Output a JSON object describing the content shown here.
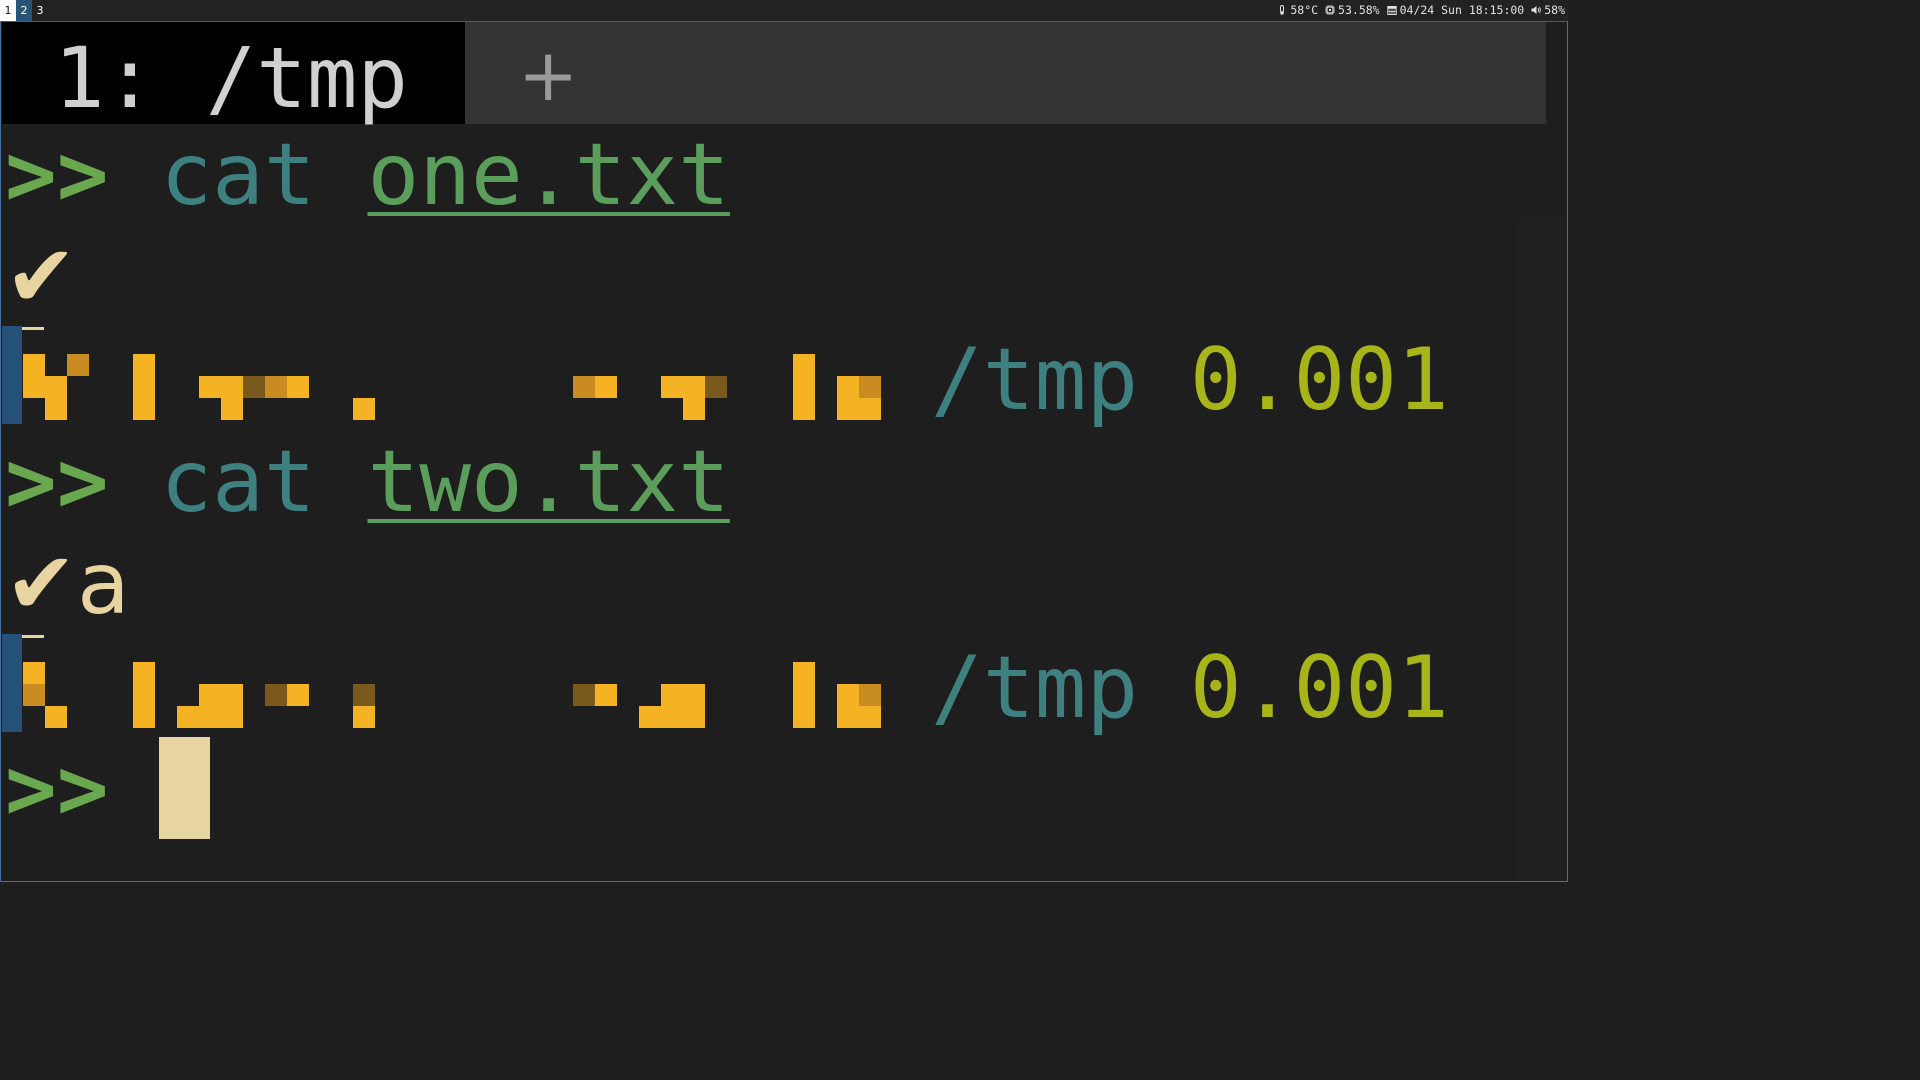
{
  "workspaces": [
    "1",
    "2",
    "3"
  ],
  "active_workspace": "2",
  "status": {
    "temp": "58°C",
    "cpu": "53.58%",
    "datetime": "04/24 Sun 18:15:00",
    "volume": "58%"
  },
  "tab": {
    "title": "1: /tmp",
    "add_label": "+"
  },
  "terminal": {
    "entries": [
      {
        "prompt": ">>",
        "command": "cat",
        "argument": "one.txt",
        "output_mark": "✔",
        "output_text": "",
        "dir": "/tmp",
        "duration": "0.001"
      },
      {
        "prompt": ">>",
        "command": "cat",
        "argument": "two.txt",
        "output_mark": "✔",
        "output_text": "a",
        "dir": "/tmp",
        "duration": "0.001"
      }
    ],
    "current_prompt": ">>"
  },
  "colors": {
    "prompt": "#6aa84f",
    "command": "#3e8080",
    "argument": "#5b9e5b",
    "duration": "#a8b518",
    "spark_bright": "#f5b323",
    "spark_mid": "#c88c22",
    "spark_dim": "#7a5a1c",
    "gutter": "#255078"
  }
}
